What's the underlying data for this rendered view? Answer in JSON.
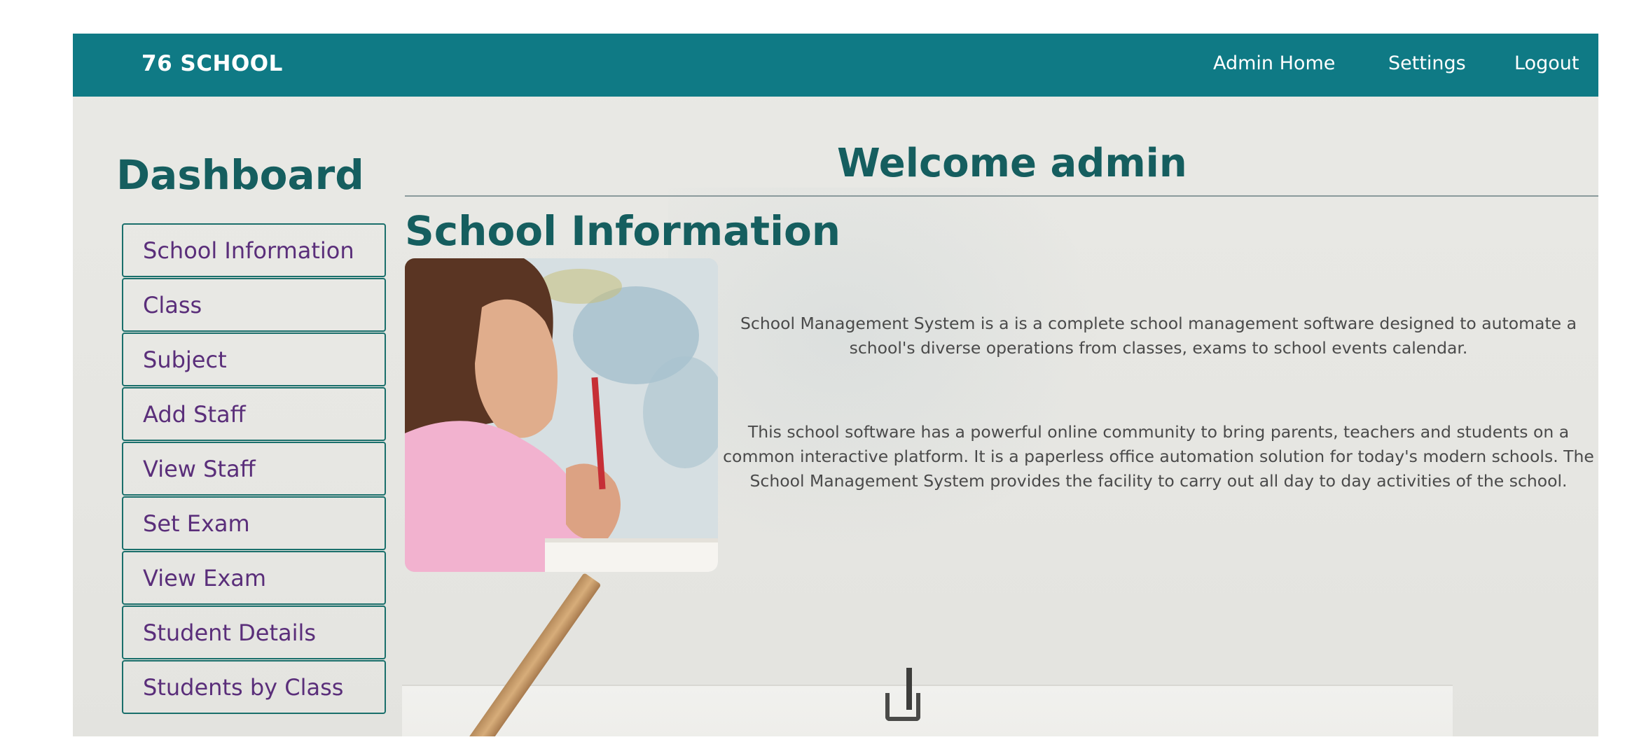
{
  "navbar": {
    "brand": "76 SCHOOL",
    "links": [
      "Admin Home",
      "Settings",
      "Logout"
    ]
  },
  "sidebar": {
    "title": "Dashboard",
    "items": [
      "School Information",
      "Class",
      "Subject",
      "Add Staff",
      "View Staff",
      "Set Exam",
      "View Exam",
      "Student Details",
      "Students by Class"
    ]
  },
  "main": {
    "welcome": "Welcome admin",
    "section_title": "School Information",
    "paragraphs": [
      "School Management System is a is a complete school management software designed to automate a school's diverse operations from classes, exams to school events calendar.",
      "This school software has a powerful online community to bring parents, teachers and students on a common interactive platform. It is a paperless office automation solution for today's modern schools. The School Management System provides the facility to carry out all day to day activities of the school."
    ]
  },
  "colors": {
    "navbar": "#0f7a85",
    "heading": "#155e5f",
    "menu_text": "#5a2e7a",
    "menu_border": "#1a6f6b",
    "body_text": "#4a4a4a"
  }
}
